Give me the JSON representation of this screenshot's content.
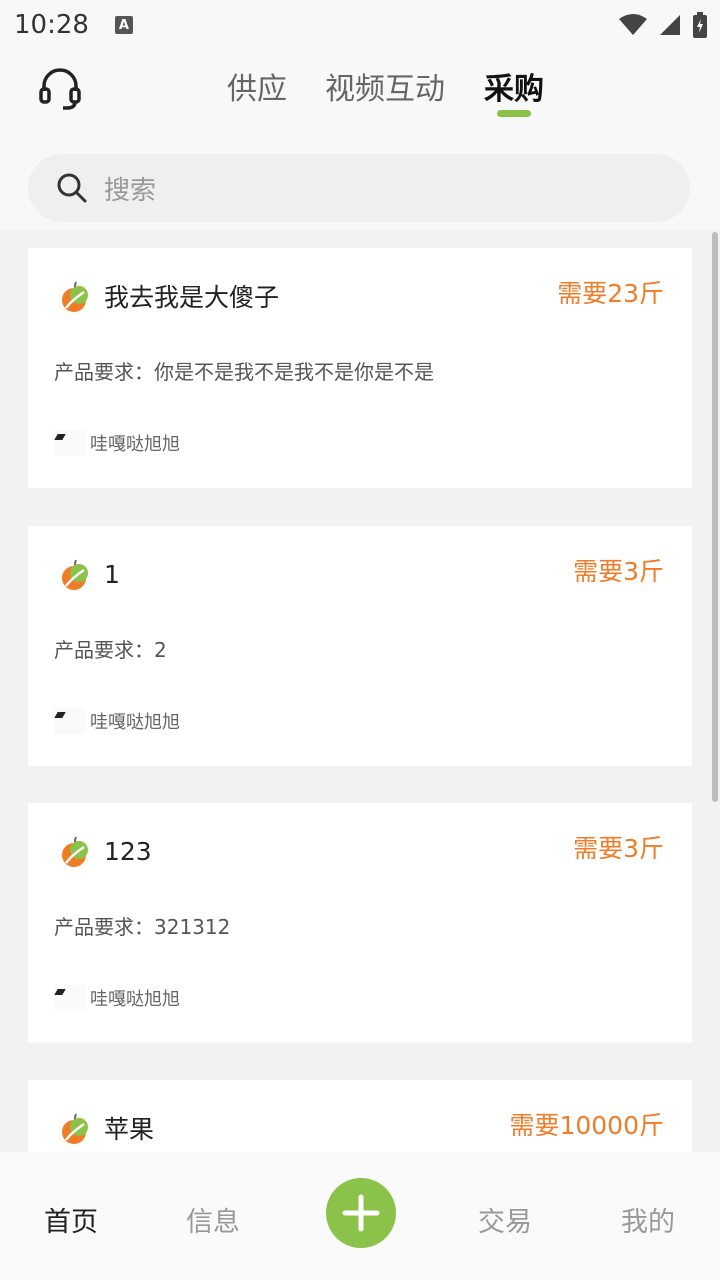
{
  "status": {
    "time": "10:28",
    "notif": "A"
  },
  "header": {
    "tabs": [
      {
        "label": "供应"
      },
      {
        "label": "视频互动"
      },
      {
        "label": "采购"
      }
    ]
  },
  "search": {
    "placeholder": "搜索"
  },
  "cards": [
    {
      "title": "我去我是大傻子",
      "qty": "需要23斤",
      "req": "产品要求：你是不是我不是我不是你是不是",
      "user": "哇嘎哒旭旭"
    },
    {
      "title": "1",
      "qty": "需要3斤",
      "req": "产品要求：2",
      "user": "哇嘎哒旭旭"
    },
    {
      "title": "123",
      "qty": "需要3斤",
      "req": "产品要求：321312",
      "user": "哇嘎哒旭旭"
    },
    {
      "title": "苹果",
      "qty": "需要10000斤"
    }
  ],
  "nav": {
    "items": [
      {
        "label": "首页"
      },
      {
        "label": "信息"
      },
      {
        "label": "交易"
      },
      {
        "label": "我的"
      }
    ]
  },
  "colors": {
    "accent_green": "#8bc34a",
    "qty_orange": "#f07c27"
  },
  "icons": [
    "headset-icon",
    "search-icon",
    "fruit-logo-icon",
    "plus-icon",
    "wifi-icon",
    "signal-icon",
    "battery-icon"
  ]
}
